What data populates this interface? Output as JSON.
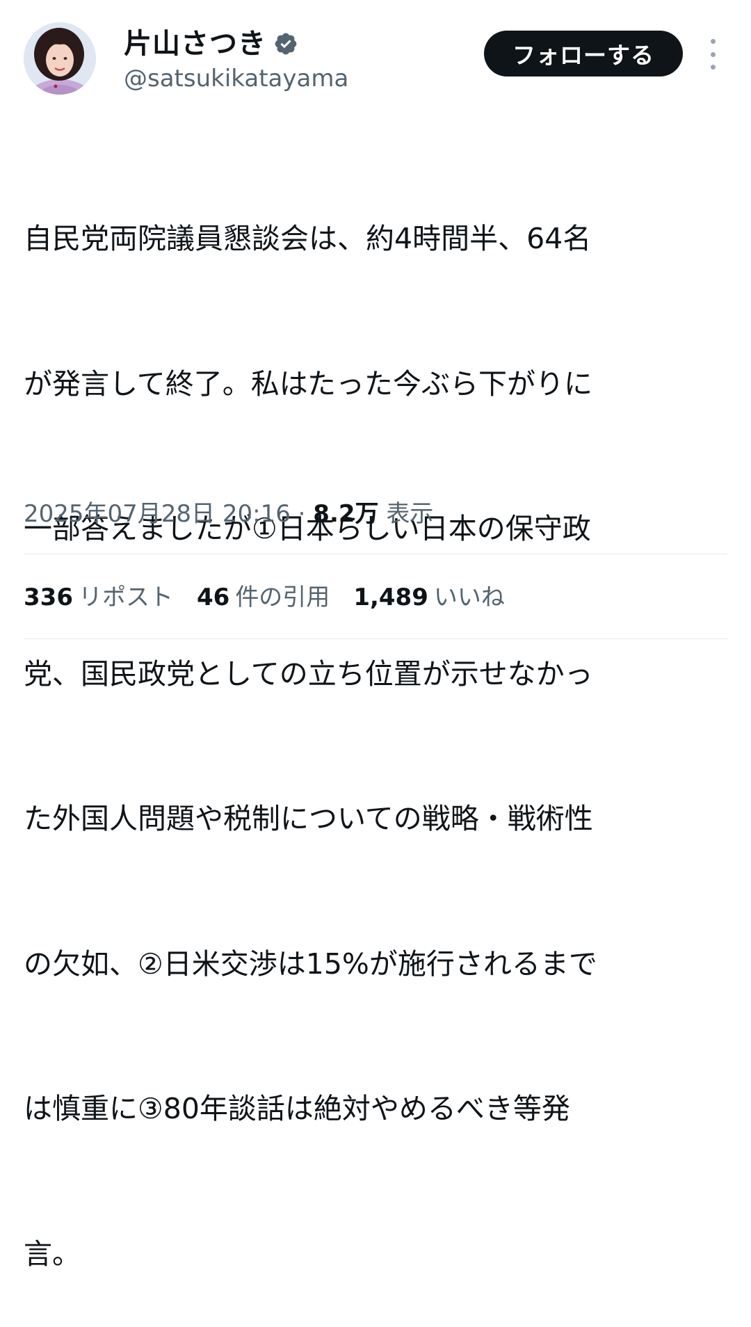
{
  "author": {
    "display_name": "片山さつき",
    "handle": "@satsukikatayama",
    "verified": true
  },
  "actions": {
    "follow_label": "フォローする"
  },
  "tweet": {
    "text_lines": [
      "自民党両院議員懇談会は、約4時間半、64名",
      "が発言して終了。私はたった今ぶら下がりに",
      "一部答えましたが①日本らしい日本の保守政",
      "党、国民政党としての立ち位置が示せなかっ",
      "た外国人問題や税制についての戦略・戦術性",
      "の欠如、②日米交渉は15%が施行されるまで",
      "は慎重に③80年談話は絶対やめるべき等発",
      "言。"
    ],
    "timestamp": "2025年07月28日 20:16",
    "separator": "·",
    "views_count": "8.2万",
    "views_label": "表示"
  },
  "stats": {
    "reposts_count": "336",
    "reposts_label": "リポスト",
    "quotes_count": "46",
    "quotes_label": "件の引用",
    "likes_count": "1,489",
    "likes_label": "いいね"
  },
  "colors": {
    "text_primary": "#0f1419",
    "text_secondary": "#536471",
    "verified_blue": "#1d9bf0",
    "follow_bg": "#0f1419",
    "divider": "#e6e9eb"
  },
  "icons": {
    "verified": "verified-badge-icon",
    "more": "more-options-icon",
    "avatar": "profile-avatar"
  }
}
